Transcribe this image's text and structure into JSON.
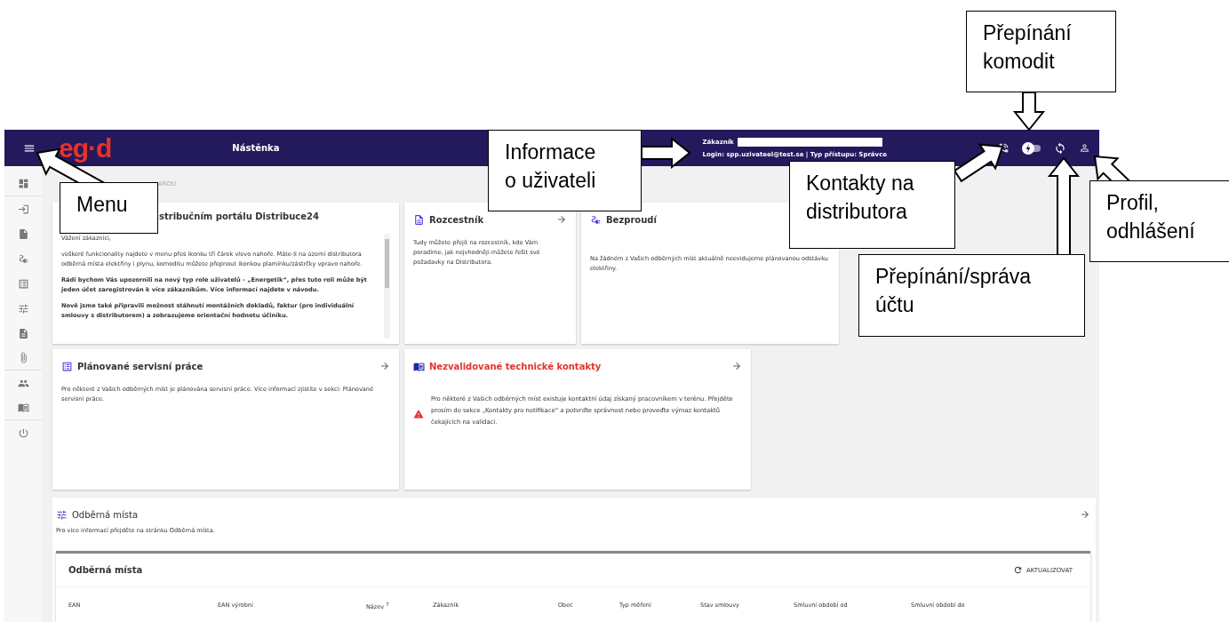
{
  "header": {
    "logo": "eg·d",
    "title": "Nástěnka",
    "customer_label": "Zákazník",
    "login": "Login: spp.uzivateel@test.se | Typ přístupu: Správce"
  },
  "breadcrumb": "ARDU",
  "cards": [
    {
      "kind": "welcome",
      "title": "stribučním portálu Distribuce24",
      "paragraphs": [
        {
          "text": "Vážení zákazníci,",
          "bold": false
        },
        {
          "text": "veškeré funkcionality najdete v menu přes ikonku tří čárek vlevo nahoře. Máte-li na území distributora odběrná místa elektřiny i plynu, komoditu můžete přepnout ikonkou plamínku/zástrčky vpravo nahoře.",
          "bold": false
        },
        {
          "text": "Rádi bychom Vás upozornili na nový typ role uživatelů - „Energetik“, přes tuto roli může být jeden účet zaregistrován k více zákazníkům. Více informací najdete v návodu.",
          "bold": true
        },
        {
          "text": "Nově jsme také připravili možnost stáhnutí montážních dokladů, faktur (pro individuální smlouvy s distributorem) a zobrazujeme orientační hodnotu účiníku.",
          "bold": true
        }
      ]
    },
    {
      "kind": "doc",
      "title": "Rozcestník",
      "arrow": true,
      "body": "Tudy můžete přejít na rozcestník, kde Vám poradíme, jak nejvhodněji můžete řešit své požadavky na Distributora."
    },
    {
      "kind": "outage",
      "title": "Bezproudí",
      "arrow": false,
      "body": "Na žádném z Vašich odběrných míst aktuálně neevidujeme plánovanou odstávku elektřiny."
    },
    {
      "kind": "list",
      "title": "Plánované servisní práce",
      "arrow": true,
      "body": "Pro některé z Vašich odběrných míst je plánována servisní práce. Více informací zjistíte v sekci: Plánované servisní práce."
    },
    {
      "kind": "warning",
      "title": "Nezvalidované technické kontakty",
      "arrow": true,
      "body": "Pro některé z Vašich odběrných míst existuje kontaktní údaj získaný pracovníkem v terénu. Přejděte prosím do sekce „Kontakty pro notifikace“ a potvrďte správnost nebo proveďte výmaz kontaktů čekajících na validaci."
    }
  ],
  "points": {
    "title": "Odběrná místa",
    "hint": "Pro více informací přejděte na stránku Odběrná místa.",
    "table_title": "Odběrná místa",
    "refresh": "AKTUALIZOVAT",
    "columns": [
      "EAN",
      "EAN výrobní",
      "Název $^{7}$",
      "Zákazník",
      "Obec",
      "Typ měření",
      "Stav smlouvy",
      "Smluvní období od",
      "Smluvní období do"
    ]
  },
  "annotations": [
    {
      "text": "Přepínání\nkomodit"
    },
    {
      "text": "Informace\no uživateli"
    },
    {
      "text": "Menu"
    },
    {
      "text": "Kontakty na\ndistributora"
    },
    {
      "text": "Profil,\nodhlášení"
    },
    {
      "text": "Přepínání/správa\núčtu"
    }
  ]
}
